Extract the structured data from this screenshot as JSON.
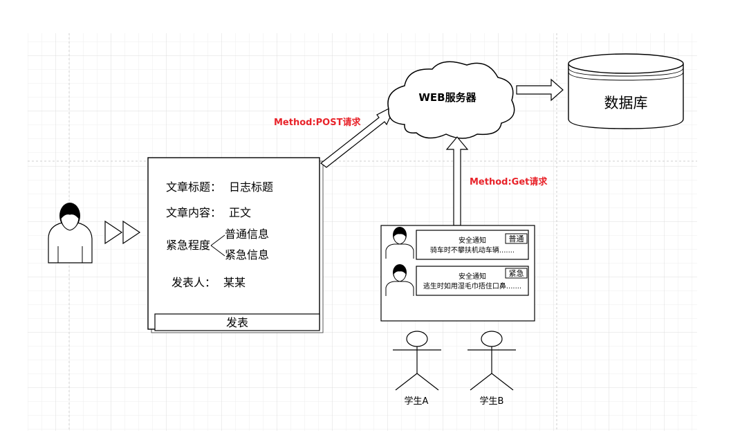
{
  "server": {
    "label": "WEB服务器"
  },
  "database": {
    "label": "数据库"
  },
  "requests": {
    "post": "Method:POST请求",
    "get": "Method:Get请求"
  },
  "form": {
    "title_label": "文章标题：",
    "title_value": "日志标题",
    "content_label": "文章内容：",
    "content_value": "正文",
    "urgency_label": "紧急程度",
    "urgency_options": [
      "普通信息",
      "紧急信息"
    ],
    "author_label": "发表人：",
    "author_value": "某某",
    "submit_label": "发表"
  },
  "notices": [
    {
      "title": "安全通知",
      "text": "骑车时不攀扶机动车辆.......",
      "tag": "普通"
    },
    {
      "title": "安全通知",
      "text": "逃生时如用湿毛巾捂住口鼻.......",
      "tag": "紧急"
    }
  ],
  "students": [
    "学生A",
    "学生B"
  ],
  "colors": {
    "request_label": "#e8232a",
    "line": "#000000"
  }
}
